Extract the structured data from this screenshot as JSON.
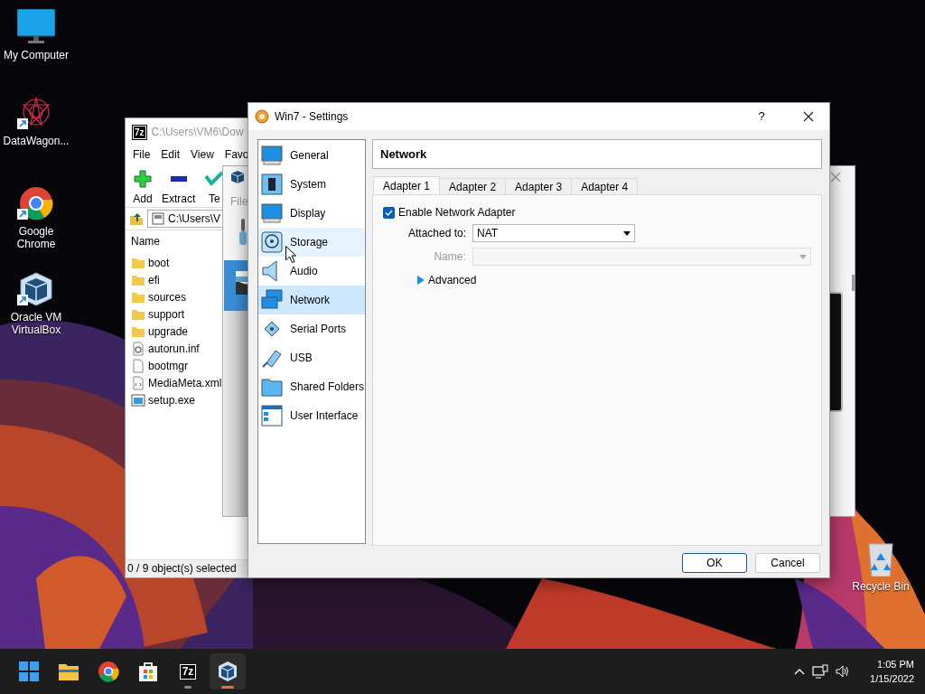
{
  "desktop_icons": [
    {
      "label": "My Computer",
      "kind": "computer",
      "shortcut": false
    },
    {
      "label": "DataWagon...",
      "kind": "datawagon",
      "shortcut": true
    },
    {
      "label": "Google Chrome",
      "kind": "chrome",
      "shortcut": true
    },
    {
      "label": "Oracle VM VirtualBox",
      "kind": "virtualbox",
      "shortcut": true
    },
    {
      "label": "Recycle Bin",
      "kind": "recycle",
      "shortcut": false
    }
  ],
  "archive_window": {
    "logo": "7z",
    "title": "C:\\Users\\VM6\\Dow",
    "menu": [
      "File",
      "Edit",
      "View",
      "Favo"
    ],
    "toolbar": [
      {
        "label": "Add",
        "kind": "add"
      },
      {
        "label": "Extract",
        "kind": "extract"
      },
      {
        "label": "Te",
        "kind": "test"
      }
    ],
    "address": "C:\\Users\\V",
    "column": "Name",
    "files": [
      {
        "name": "boot",
        "kind": "folder"
      },
      {
        "name": "efi",
        "kind": "folder"
      },
      {
        "name": "sources",
        "kind": "folder"
      },
      {
        "name": "support",
        "kind": "folder"
      },
      {
        "name": "upgrade",
        "kind": "folder"
      },
      {
        "name": "autorun.inf",
        "kind": "settings"
      },
      {
        "name": "bootmgr",
        "kind": "file"
      },
      {
        "name": "MediaMeta.xml",
        "kind": "xml"
      },
      {
        "name": "setup.exe",
        "kind": "exe"
      }
    ],
    "status": "0 / 9 object(s) selected"
  },
  "manager_window": {
    "menu": [
      "File"
    ]
  },
  "settings_dialog": {
    "title": "Win7 - Settings",
    "help": "?",
    "sections": [
      {
        "label": "General",
        "selected": false,
        "hovered": false
      },
      {
        "label": "System",
        "selected": false,
        "hovered": false
      },
      {
        "label": "Display",
        "selected": false,
        "hovered": false
      },
      {
        "label": "Storage",
        "selected": false,
        "hovered": true
      },
      {
        "label": "Audio",
        "selected": false,
        "hovered": false
      },
      {
        "label": "Network",
        "selected": true,
        "hovered": false
      },
      {
        "label": "Serial Ports",
        "selected": false,
        "hovered": false
      },
      {
        "label": "USB",
        "selected": false,
        "hovered": false
      },
      {
        "label": "Shared Folders",
        "selected": false,
        "hovered": false
      },
      {
        "label": "User Interface",
        "selected": false,
        "hovered": false
      }
    ],
    "header": "Network",
    "tabs": [
      {
        "label": "Adapter 1",
        "selected": true
      },
      {
        "label": "Adapter 2",
        "selected": false
      },
      {
        "label": "Adapter 3",
        "selected": false
      },
      {
        "label": "Adapter 4",
        "selected": false
      }
    ],
    "enable": {
      "label": "Enable Network Adapter",
      "checked": true
    },
    "attached": {
      "label": "Attached to:",
      "value": "NAT"
    },
    "name_field": {
      "label": "Name:",
      "disabled": true
    },
    "advanced": {
      "label": "Advanced",
      "expanded": false
    },
    "buttons": [
      {
        "label": "OK",
        "default": true
      },
      {
        "label": "Cancel",
        "default": false
      }
    ]
  },
  "taskbar": {
    "apps": [
      {
        "kind": "start",
        "running": false,
        "active": false
      },
      {
        "kind": "explorer",
        "running": false,
        "active": false
      },
      {
        "kind": "chrome",
        "running": false,
        "active": false
      },
      {
        "kind": "store",
        "running": false,
        "active": false
      },
      {
        "kind": "sevenzip",
        "label": "7z",
        "running": true,
        "active": false
      },
      {
        "kind": "virtualbox",
        "running": true,
        "active": true
      }
    ],
    "time": "1:05 PM",
    "date": "1/15/2022"
  }
}
